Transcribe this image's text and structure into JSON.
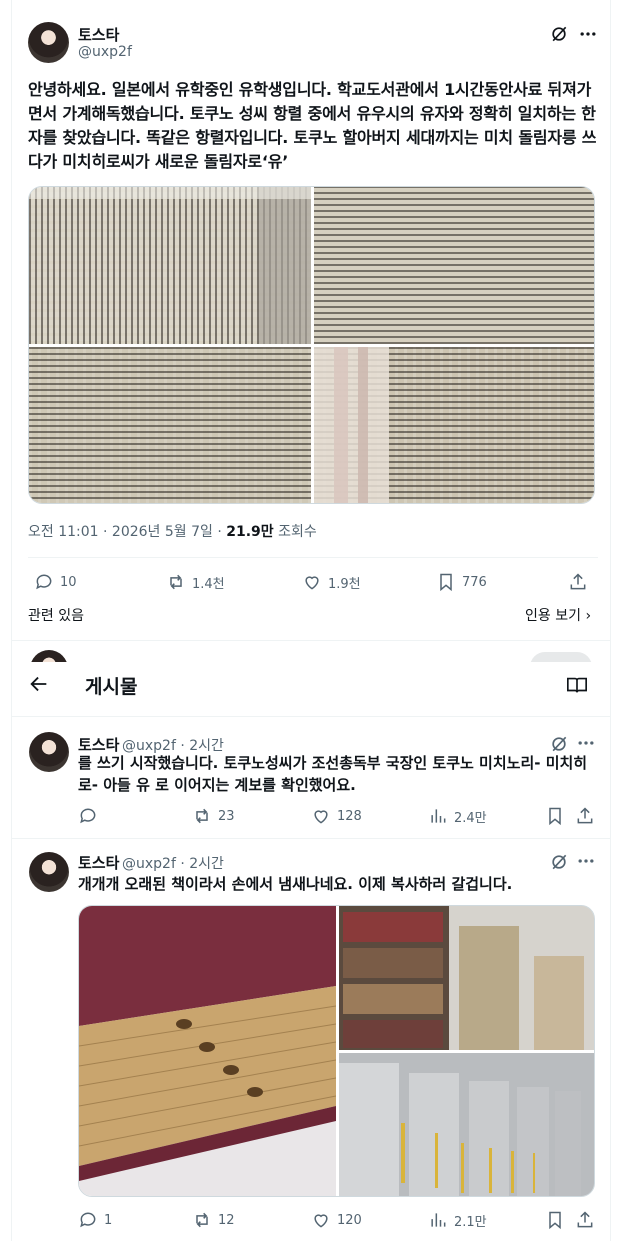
{
  "main_tweet": {
    "name": "토스타",
    "handle": "@uxp2f",
    "text": "안녕하세요. 일본에서 유학중인 유학생입니다. 학교도서관에서 1시간동안사료 뒤져가면서 가계해독했습니다. 토쿠노 성씨 항렬 중에서 유우시의 유자와 정확히 일치하는 한자를 찾았습니다.  똑같은 항렬자입니다. 토쿠노 할아버지 세대까지는 미치 돌림자릉 쓰다가 미치히로씨가 새로운 돌림자로‘유’",
    "time": "오전 11:01 · 2026년 5월 7일 · ",
    "views": "21.9만",
    "views_label": " 조회수",
    "replies": "10",
    "reposts": "1.4천",
    "likes": "1.9천",
    "bookmarks": "776",
    "related": "관련 있음",
    "quotes": "인용 보기"
  },
  "header": {
    "title": "게시물"
  },
  "replies": [
    {
      "name": "토스타",
      "meta": "@uxp2f · 2시간",
      "text": "를 쓰기 시작했습니다. 토쿠노성씨가 조선총독부 국장인 토쿠노 미치노리- 미치히로- 아들 유 로 이어지는 계보를 확인했어요.",
      "replies": "",
      "reposts": "23",
      "likes": "128",
      "views": "2.4만"
    },
    {
      "name": "토스타",
      "meta": "@uxp2f · 2시간",
      "text": "개개개 오래된 책이라서 손에서 냄새나네요. 이제 복사하러 갈겁니다.",
      "replies": "1",
      "reposts": "12",
      "likes": "120",
      "views": "2.1만"
    }
  ],
  "icons": {
    "grok": "grok-icon",
    "more": "more-icon",
    "reply": "reply-icon",
    "repost": "repost-icon",
    "like": "heart-icon",
    "bookmark": "bookmark-icon",
    "share": "share-icon",
    "views": "views-icon",
    "back": "back-arrow-icon",
    "reader": "reader-icon"
  },
  "colors": {
    "text": "#0f1419",
    "muted": "#536471",
    "border": "#eff3f4"
  }
}
